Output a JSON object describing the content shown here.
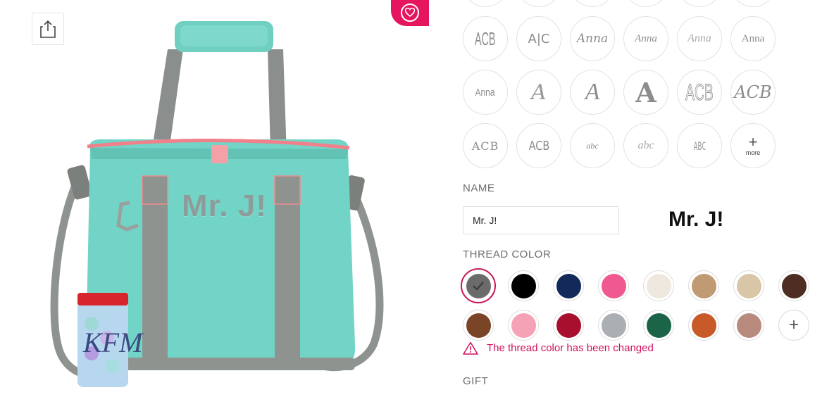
{
  "product": {
    "bag_personalization_text": "Mr. J!"
  },
  "fonts": {
    "row2": [
      {
        "sample": "ACB",
        "name": "font-option-slim-monogram"
      },
      {
        "sample": "A|C",
        "name": "font-option-divided-monogram"
      },
      {
        "sample": "Anna",
        "name": "font-option-script-anna"
      },
      {
        "sample": "Anna",
        "name": "font-option-italic-anna"
      },
      {
        "sample": "Anna",
        "name": "font-option-thin-script-anna"
      },
      {
        "sample": "Anna",
        "name": "font-option-serif-anna"
      }
    ],
    "row3": [
      {
        "sample": "Anna",
        "name": "font-option-narrow-anna"
      },
      {
        "sample": "A",
        "name": "font-option-ornate-letter"
      },
      {
        "sample": "A",
        "name": "font-option-flourish-letter"
      },
      {
        "sample": "A",
        "name": "font-option-block-letter"
      },
      {
        "sample": "ACB",
        "name": "font-option-outline-monogram"
      },
      {
        "sample": "ACB",
        "name": "font-option-vine-monogram"
      }
    ],
    "row4": [
      {
        "sample": "ACB",
        "name": "font-option-classic-monogram"
      },
      {
        "sample": "ACB",
        "name": "font-option-thin-monogram"
      },
      {
        "sample": "abc",
        "name": "font-option-lowercase-script"
      },
      {
        "sample": "abc",
        "name": "font-option-handwriting"
      },
      {
        "sample": "ABC",
        "name": "font-option-stencil"
      }
    ],
    "more_label": "more",
    "more_icon": "+"
  },
  "name_section": {
    "label": "NAME",
    "input_value": "Mr. J!",
    "preview": "Mr. J!"
  },
  "thread_section": {
    "label": "THREAD COLOR",
    "row1": [
      "#6b6b6b",
      "#000000",
      "#13295a",
      "#f05890",
      "#efe8de",
      "#c09a72",
      "#d8c6a6",
      "#4e2e22"
    ],
    "row2": [
      "#7a4426",
      "#f5a2b6",
      "#a80f2f",
      "#abaeb3",
      "#1b6447",
      "#c85a28",
      "#b88a7e"
    ],
    "add_icon": "+",
    "alert_text": "The thread color has been changed"
  },
  "gift_section": {
    "label": "GIFT"
  },
  "colors": {
    "accent": "#e5155f",
    "alert": "#d0105c"
  }
}
